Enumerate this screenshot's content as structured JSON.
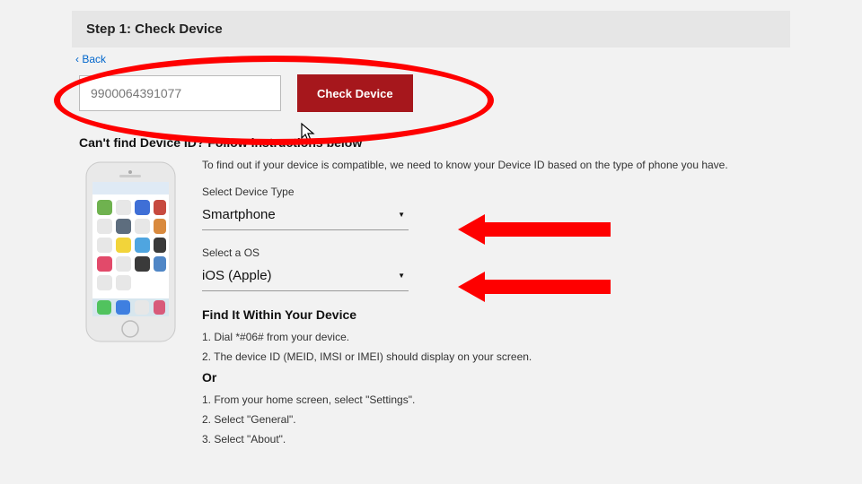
{
  "header": {
    "step_title": "Step 1: Check Device"
  },
  "back": {
    "label": "Back"
  },
  "input": {
    "value": "9900064391077",
    "button_label": "Check Device"
  },
  "cant_find": {
    "heading": "Can't find Device ID? Follow instructions below"
  },
  "intro": {
    "text": "To find out if your device is compatible, we need to know your Device ID based on the type of phone you have."
  },
  "device_type": {
    "label": "Select Device Type",
    "value": "Smartphone"
  },
  "os": {
    "label": "Select a OS",
    "value": "iOS (Apple)"
  },
  "find_it": {
    "heading": "Find It Within Your Device",
    "step1": "1. Dial *#06# from your device.",
    "step2": "2. The device ID (MEID, IMSI or IMEI) should display on your screen."
  },
  "or": {
    "heading": "Or",
    "step1": "1. From your home screen, select \"Settings\".",
    "step2": "2. Select \"General\".",
    "step3": "3. Select \"About\"."
  },
  "annotations": {
    "ellipse": {
      "color": "#fe0000"
    },
    "arrow1": {
      "color": "#fe0000"
    },
    "arrow2": {
      "color": "#fe0000"
    }
  }
}
